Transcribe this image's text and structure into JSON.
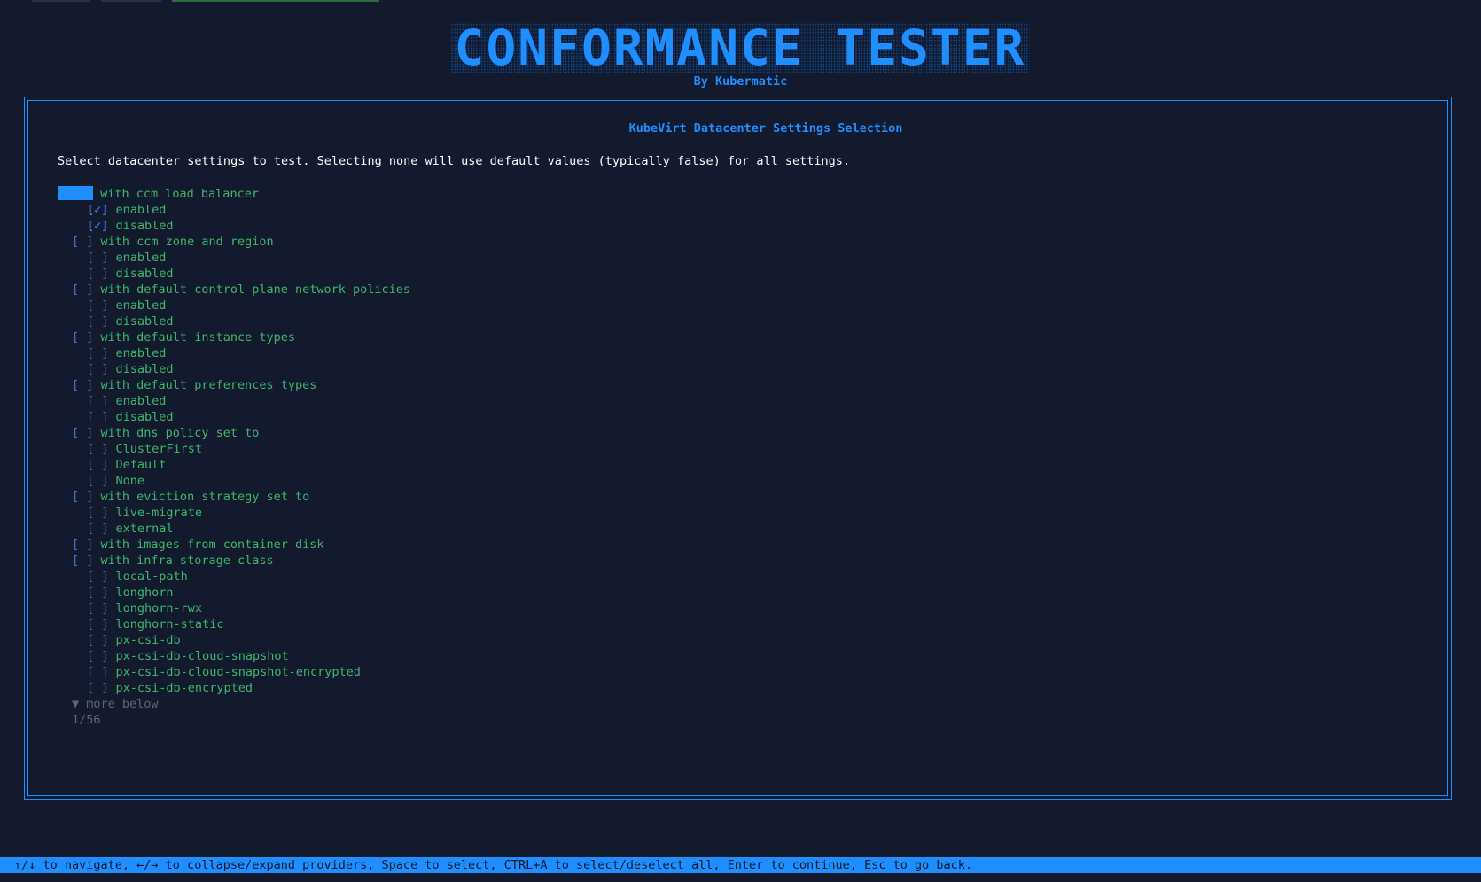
{
  "header": {
    "logo_text": "CONFORMANCE TESTER",
    "by_line": "By Kubermatic"
  },
  "panel": {
    "title": "KubeVirt Datacenter Settings Selection",
    "instructions": "Select datacenter settings to test. Selecting none will use default values (typically false) for all settings."
  },
  "tree": [
    {
      "level": 0,
      "box": "",
      "label": "with ccm load balancer",
      "focused": true,
      "checked": false
    },
    {
      "level": 1,
      "box": "[✓]",
      "label": "enabled",
      "checked": true
    },
    {
      "level": 1,
      "box": "[✓]",
      "label": "disabled",
      "checked": true
    },
    {
      "level": 0,
      "box": "[ ]",
      "label": "with ccm zone and region"
    },
    {
      "level": 1,
      "box": "[ ]",
      "label": "enabled"
    },
    {
      "level": 1,
      "box": "[ ]",
      "label": "disabled"
    },
    {
      "level": 0,
      "box": "[ ]",
      "label": "with default control plane network policies"
    },
    {
      "level": 1,
      "box": "[ ]",
      "label": "enabled"
    },
    {
      "level": 1,
      "box": "[ ]",
      "label": "disabled"
    },
    {
      "level": 0,
      "box": "[ ]",
      "label": "with default instance types"
    },
    {
      "level": 1,
      "box": "[ ]",
      "label": "enabled"
    },
    {
      "level": 1,
      "box": "[ ]",
      "label": "disabled"
    },
    {
      "level": 0,
      "box": "[ ]",
      "label": "with default preferences types"
    },
    {
      "level": 1,
      "box": "[ ]",
      "label": "enabled"
    },
    {
      "level": 1,
      "box": "[ ]",
      "label": "disabled"
    },
    {
      "level": 0,
      "box": "[ ]",
      "label": "with dns policy set to"
    },
    {
      "level": 1,
      "box": "[ ]",
      "label": "ClusterFirst"
    },
    {
      "level": 1,
      "box": "[ ]",
      "label": "Default"
    },
    {
      "level": 1,
      "box": "[ ]",
      "label": "None"
    },
    {
      "level": 0,
      "box": "[ ]",
      "label": "with eviction strategy set to"
    },
    {
      "level": 1,
      "box": "[ ]",
      "label": "live-migrate"
    },
    {
      "level": 1,
      "box": "[ ]",
      "label": "external"
    },
    {
      "level": 0,
      "box": "[ ]",
      "label": "with images from container disk"
    },
    {
      "level": 0,
      "box": "[ ]",
      "label": "with infra storage class"
    },
    {
      "level": 1,
      "box": "[ ]",
      "label": "local-path"
    },
    {
      "level": 1,
      "box": "[ ]",
      "label": "longhorn"
    },
    {
      "level": 1,
      "box": "[ ]",
      "label": "longhorn-rwx"
    },
    {
      "level": 1,
      "box": "[ ]",
      "label": "longhorn-static"
    },
    {
      "level": 1,
      "box": "[ ]",
      "label": "px-csi-db"
    },
    {
      "level": 1,
      "box": "[ ]",
      "label": "px-csi-db-cloud-snapshot"
    },
    {
      "level": 1,
      "box": "[ ]",
      "label": "px-csi-db-cloud-snapshot-encrypted"
    },
    {
      "level": 1,
      "box": "[ ]",
      "label": "px-csi-db-encrypted"
    }
  ],
  "scroll": {
    "more_below": "▼ more below",
    "position": "1/56"
  },
  "status_bar": {
    "help_text": "↑/↓ to navigate, ←/→ to collapse/expand providers, Space to select, CTRL+A to select/deselect all, Enter to continue, Esc to go back."
  },
  "colors": {
    "background": "#131a2e",
    "accent": "#1f8fff",
    "label_green": "#3fb76c",
    "muted": "#5f6678"
  }
}
